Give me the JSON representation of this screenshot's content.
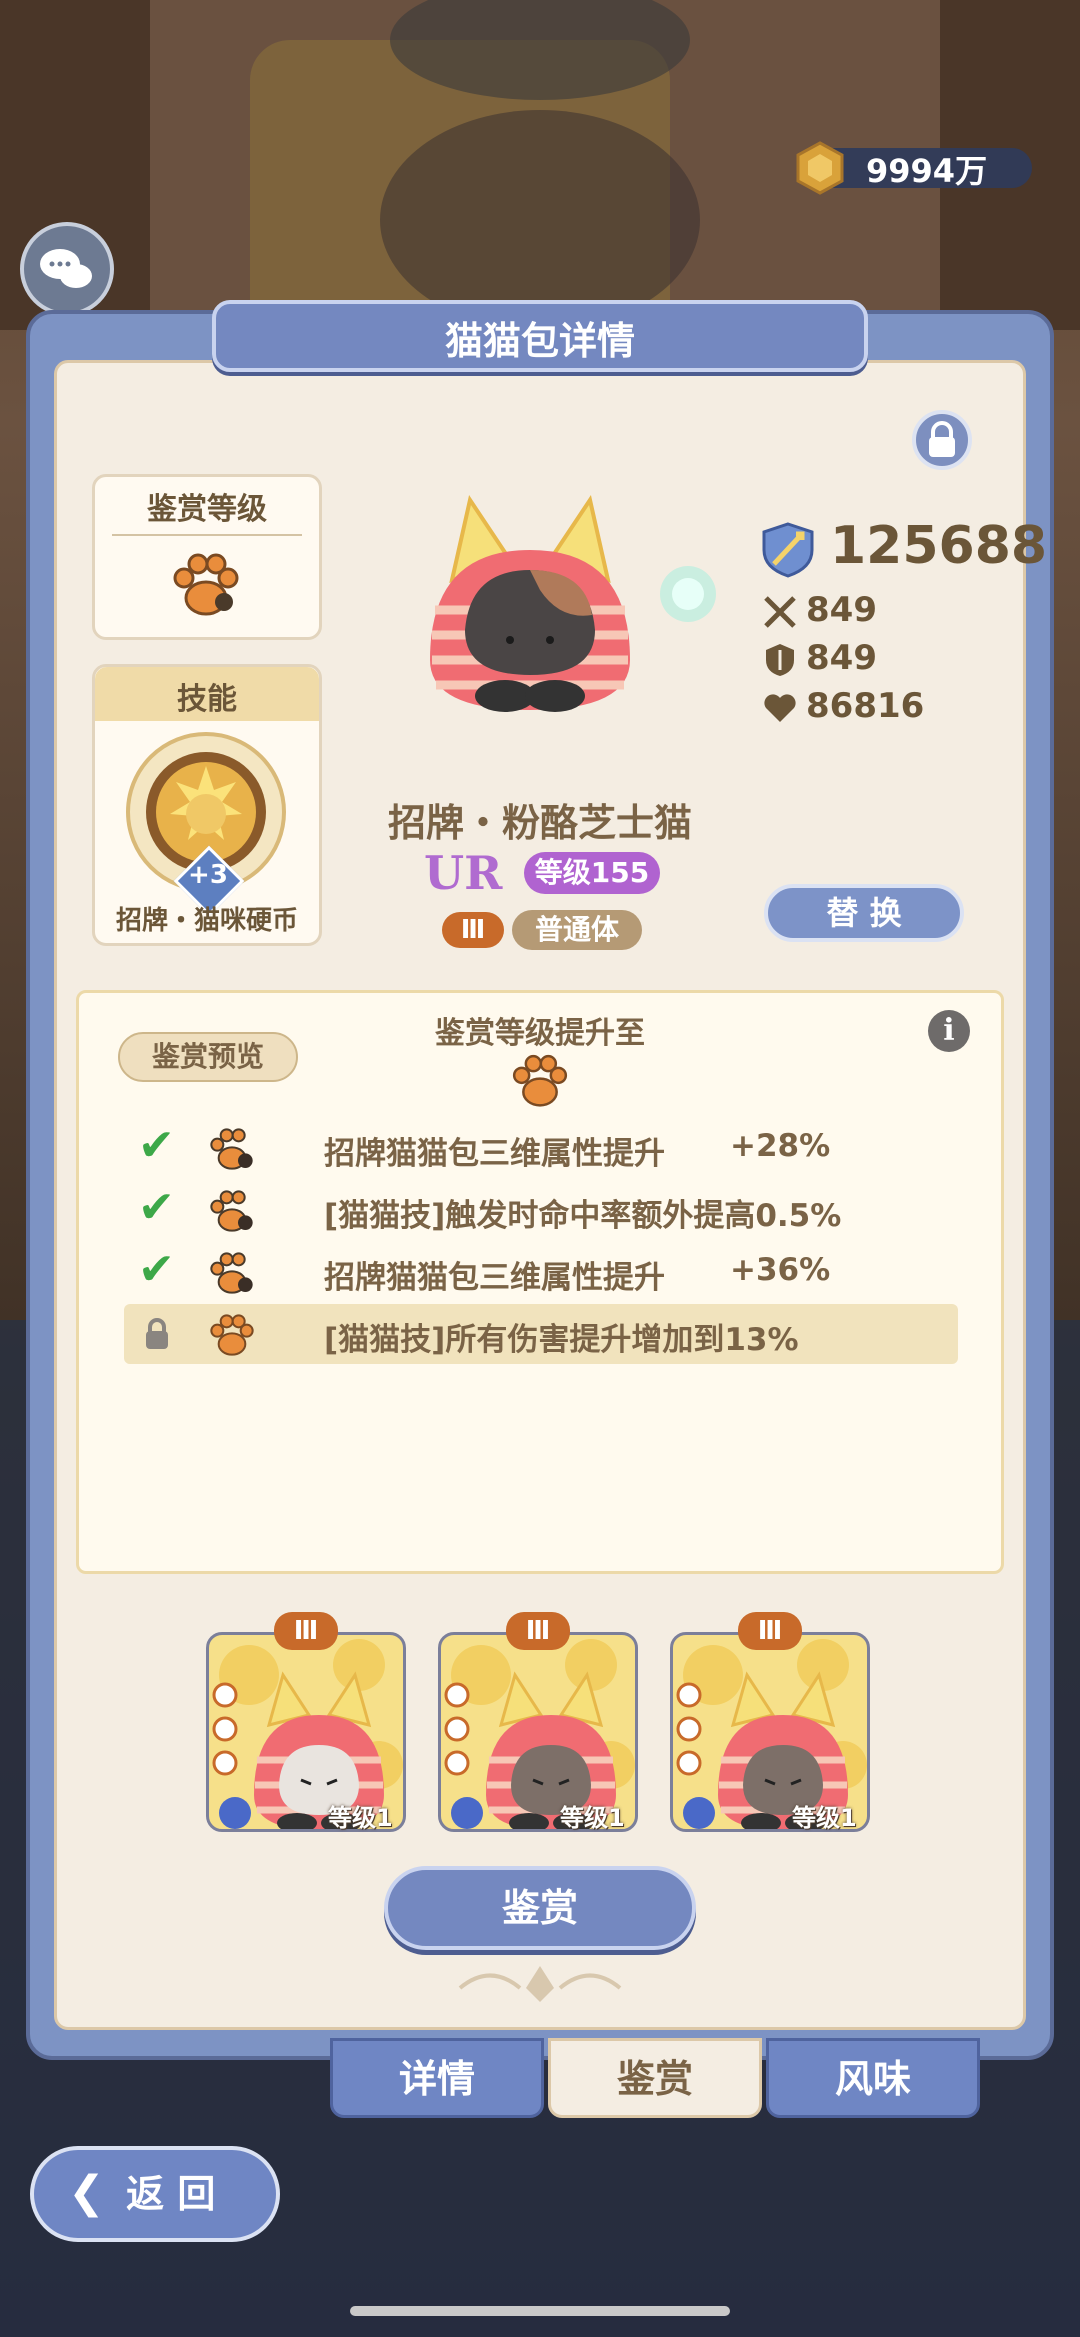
{
  "header": {
    "currency_value": "9994万",
    "panel_title": "猫猫包详情"
  },
  "left": {
    "appraise_level_label": "鉴赏等级",
    "skill_label": "技能",
    "skill_badge": "+3",
    "skill_name": "招牌・猫咪硬币"
  },
  "cat": {
    "power": "125688",
    "attack": "849",
    "defense": "849",
    "hp": "86816",
    "name": "招牌・粉酪芝士猫",
    "rarity": "UR",
    "level": "等级155",
    "rank": "Ⅲ",
    "body_type": "普通体",
    "replace_label": "替 换"
  },
  "appraise": {
    "title": "鉴赏等级提升至",
    "preview_label": "鉴赏预览",
    "info_icon": "i",
    "rows": [
      {
        "status": "checked",
        "text": "招牌猫猫包三维属性提升",
        "bonus": "+28%"
      },
      {
        "status": "checked",
        "text": "[猫猫技]触发时命中率额外提高0.5%",
        "bonus": ""
      },
      {
        "status": "checked",
        "text": "招牌猫猫包三维属性提升",
        "bonus": "+36%"
      },
      {
        "status": "locked",
        "text": "[猫猫技]所有伤害提升增加到13%",
        "bonus": ""
      }
    ]
  },
  "materials": [
    {
      "rank": "Ⅲ",
      "level": "等级1"
    },
    {
      "rank": "Ⅲ",
      "level": "等级1"
    },
    {
      "rank": "Ⅲ",
      "level": "等级1"
    }
  ],
  "appraise_button": "鉴赏",
  "tabs": [
    {
      "label": "详情",
      "active": false
    },
    {
      "label": "鉴赏",
      "active": true
    },
    {
      "label": "风味",
      "active": false
    }
  ],
  "back_label": "返 回",
  "colors": {
    "panel_blue": "#7d93c4",
    "cream": "#f4ede2",
    "text_brown": "#7a6346",
    "rank_orange": "#c86a2a",
    "level_purple": "#b063d0",
    "check_green": "#3da848"
  }
}
